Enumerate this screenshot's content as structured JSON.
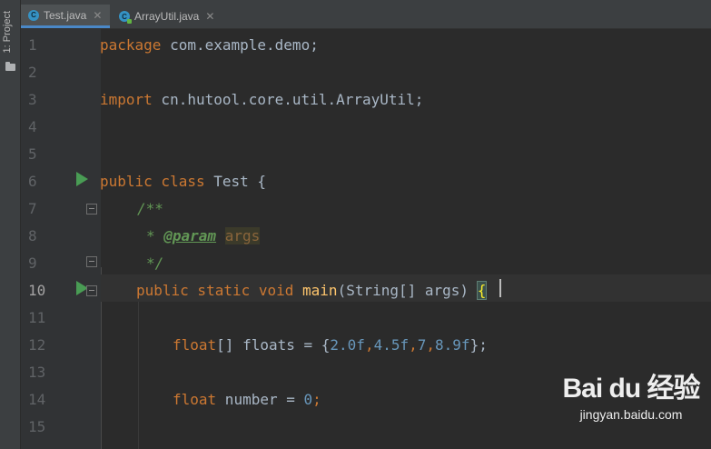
{
  "side_panel": {
    "label": "1: Project",
    "folder_icon": "folder-icon"
  },
  "tabs": [
    {
      "label": "Test.java",
      "icon": "java-class-icon",
      "active": true
    },
    {
      "label": "ArrayUtil.java",
      "icon": "java-class-icon",
      "active": false
    }
  ],
  "current_line": 10,
  "line_numbers": [
    "1",
    "2",
    "3",
    "4",
    "5",
    "6",
    "7",
    "8",
    "9",
    "10",
    "11",
    "12",
    "13",
    "14",
    "15"
  ],
  "code": {
    "l1_kw": "package",
    "l1_rest": " com.example.demo;",
    "l3_kw": "import",
    "l3_rest": " cn.hutool.core.util.ArrayUtil;",
    "l6_kw": "public class",
    "l6_rest": " Test {",
    "l7": "/**",
    "l8_star": "* ",
    "l8_tag": "@param",
    "l8_space": " ",
    "l8_arg": "args",
    "l9": "*/",
    "l10_kw": "public static void",
    "l10_sp": " ",
    "l10_fn": "main",
    "l10_rest": "(String[] args) ",
    "l10_brace": "{",
    "l12_kw": "float",
    "l12_a": "[] floats = {",
    "l12_n1": "2.0f",
    "l12_c1": ",",
    "l12_n2": "4.5f",
    "l12_c2": ",",
    "l12_n3": "7",
    "l12_c3": ",",
    "l12_n4": "8.9f",
    "l12_end": "};",
    "l14_kw": "float",
    "l14_a": " number = ",
    "l14_n": "0",
    "l14_end": ";"
  },
  "watermark": {
    "logo": "Bai du 经验",
    "url": "jingyan.baidu.com"
  },
  "colors": {
    "keyword": "#cc7832",
    "number": "#6897bb",
    "doc": "#629755",
    "method": "#ffc66d",
    "text": "#a9b7c6",
    "background": "#2b2b2b"
  }
}
